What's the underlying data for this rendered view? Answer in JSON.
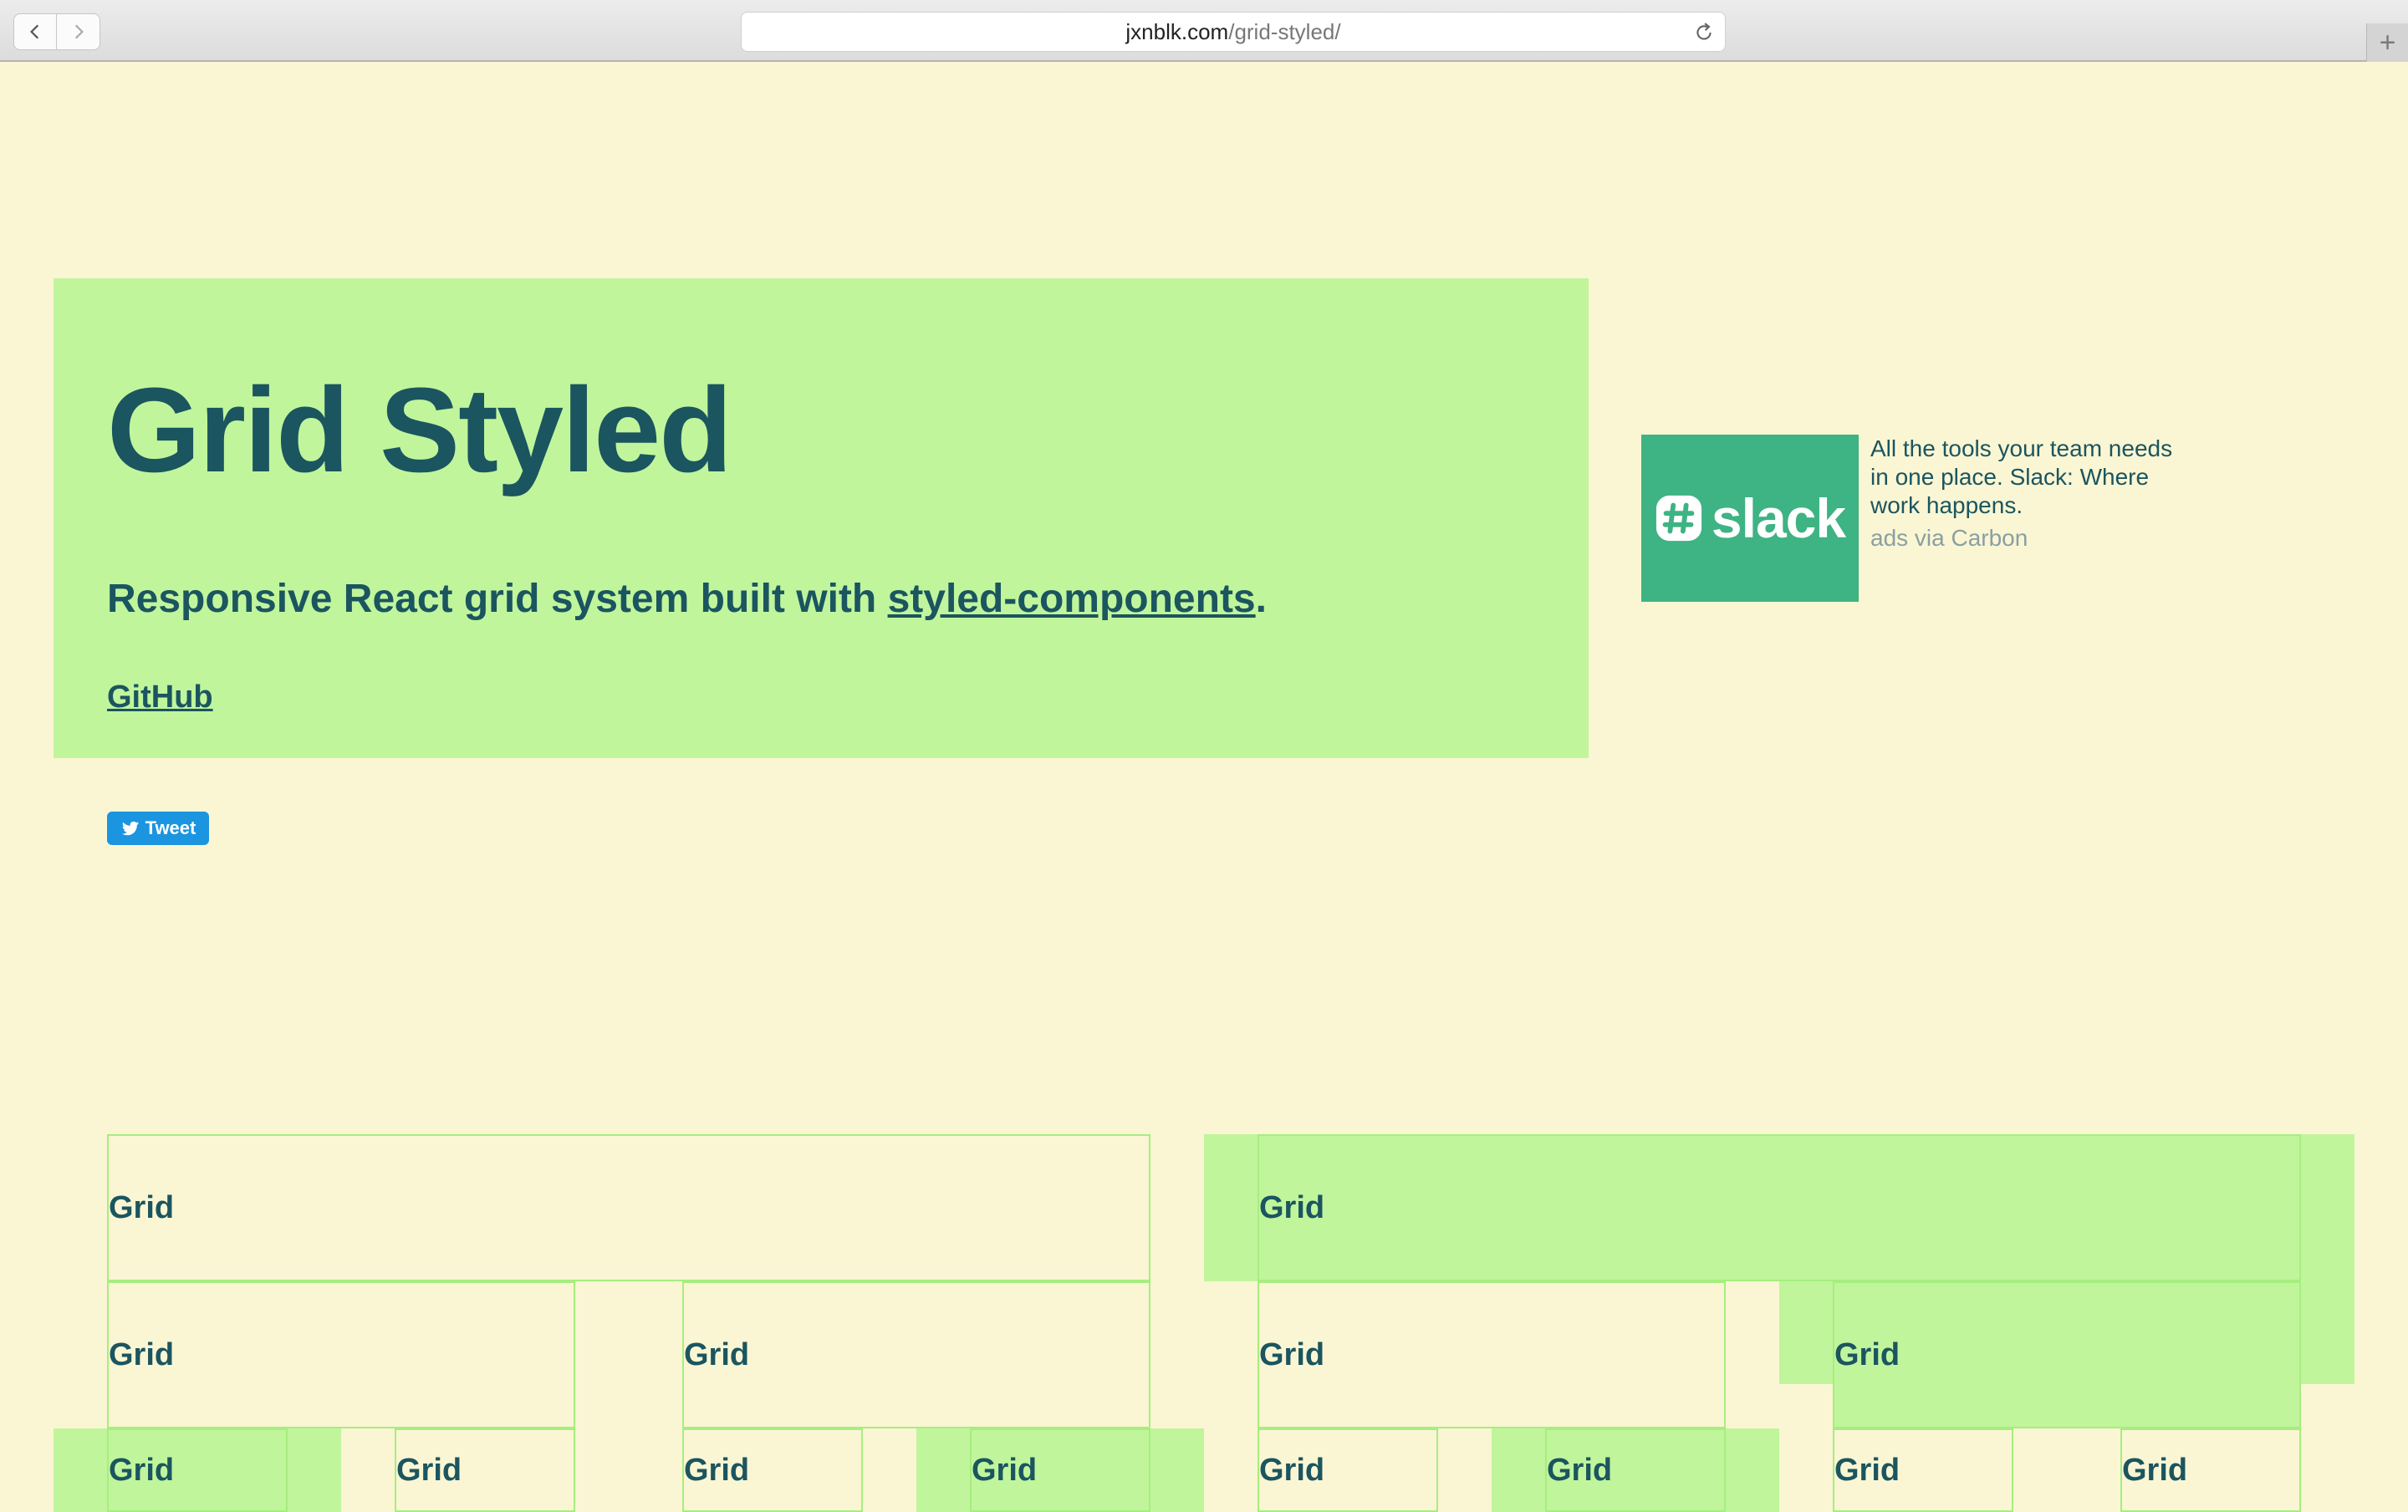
{
  "browser": {
    "url_host": "jxnblk.com",
    "url_path": "/grid-styled/",
    "icons": {
      "back": "chevron-left-icon",
      "forward": "chevron-right-icon",
      "reload": "reload-icon",
      "new_tab": "plus-icon"
    },
    "new_tab_label": "+"
  },
  "hero": {
    "title": "Grid Styled",
    "subtitle_prefix": "Responsive React grid system built with ",
    "subtitle_link": "styled-components",
    "subtitle_suffix": ".",
    "github_link": "GitHub",
    "tweet_label": "Tweet"
  },
  "ad": {
    "logo_text": "slack",
    "text": "All the tools your team needs in one place. Slack: Where work happens.",
    "via": "ads via Carbon"
  },
  "grid_demo": {
    "cell_label": "Grid"
  },
  "colors": {
    "background": "#faf6d3",
    "accent_green": "#c0f59c",
    "grid_border": "#a6ee7f",
    "text_dark": "#1b5560",
    "tweet_blue": "#1b95e0",
    "slack_green": "#3eb383"
  }
}
